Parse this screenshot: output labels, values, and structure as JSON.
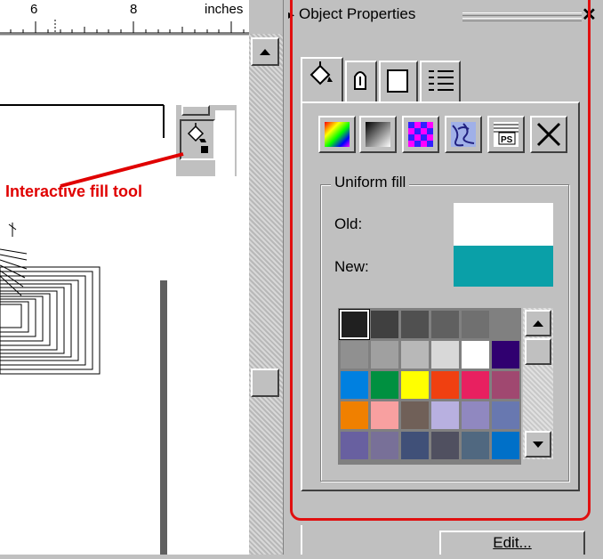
{
  "ruler": {
    "tick_6": "6",
    "tick_8": "8",
    "units": "inches"
  },
  "annotation": {
    "text": "Interactive fill tool",
    "color": "#e00000"
  },
  "docker": {
    "title": "Object Properties",
    "close_glyph": "✕",
    "arrow_glyph": "▸"
  },
  "tabs": [
    {
      "name": "fill-tab",
      "icon": "paint-bucket-icon"
    },
    {
      "name": "outline-tab",
      "icon": "pen-nib-icon"
    },
    {
      "name": "general-tab",
      "icon": "page-icon"
    },
    {
      "name": "detail-tab",
      "icon": "list-icon"
    }
  ],
  "fill_types": [
    {
      "name": "uniform-fill-button",
      "icon": "rainbow-swatch-icon"
    },
    {
      "name": "fountain-fill-button",
      "icon": "gradient-icon"
    },
    {
      "name": "pattern-fill-button",
      "icon": "checker-icon"
    },
    {
      "name": "texture-fill-button",
      "icon": "texture-icon"
    },
    {
      "name": "postscript-fill-button",
      "icon": "postscript-icon",
      "text": "PS"
    },
    {
      "name": "no-fill-button",
      "icon": "x-icon"
    }
  ],
  "uniform": {
    "legend": "Uniform fill",
    "old_label": "Old:",
    "new_label": "New:",
    "old_color": "#ffffff",
    "new_color": "#0aa0a8"
  },
  "palette_colors": [
    "#202020",
    "#404040",
    "#505050",
    "#606060",
    "#707070",
    "#808080",
    "#909090",
    "#a0a0a0",
    "#b8b8b8",
    "#d8d8d8",
    "#ffffff",
    "#300070",
    "#0080e0",
    "#009040",
    "#ffff00",
    "#f04010",
    "#e82060",
    "#a04870",
    "#f08000",
    "#f8a0a0",
    "#706058",
    "#b8b0e0",
    "#9088c0",
    "#6878b0",
    "#6860a0",
    "#787098",
    "#405078",
    "#505060",
    "#506880",
    "#0070c8"
  ],
  "edit_button": {
    "label": "Edit..."
  }
}
